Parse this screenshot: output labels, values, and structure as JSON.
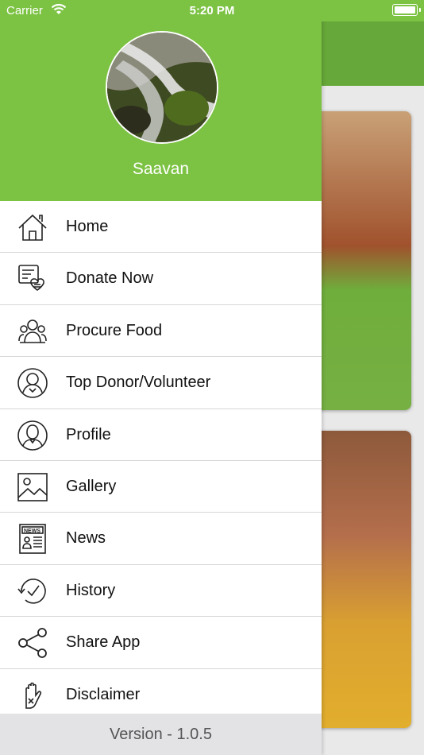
{
  "status_bar": {
    "carrier": "Carrier",
    "time": "5:20 PM"
  },
  "drawer": {
    "user_name": "Saavan",
    "menu": [
      {
        "label": "Home",
        "icon": "home-icon"
      },
      {
        "label": "Donate Now",
        "icon": "donate-icon"
      },
      {
        "label": "Procure Food",
        "icon": "procure-food-icon"
      },
      {
        "label": "Top Donor/Volunteer",
        "icon": "top-donor-icon"
      },
      {
        "label": "Profile",
        "icon": "profile-icon"
      },
      {
        "label": "Gallery",
        "icon": "gallery-icon"
      },
      {
        "label": "News",
        "icon": "news-icon"
      },
      {
        "label": "History",
        "icon": "history-icon"
      },
      {
        "label": "Share App",
        "icon": "share-icon"
      },
      {
        "label": "Disclaimer",
        "icon": "disclaimer-icon"
      }
    ],
    "version": "Version - 1.0.5"
  },
  "colors": {
    "header": "#7cc243",
    "navbar": "#67a83a"
  }
}
